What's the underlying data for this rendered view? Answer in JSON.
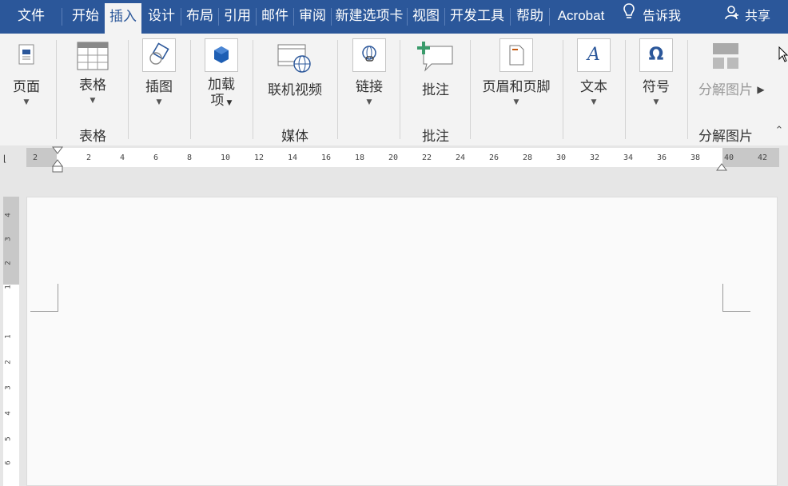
{
  "tabs": [
    {
      "label": "文件",
      "active": false
    },
    {
      "label": "开始",
      "active": false
    },
    {
      "label": "插入",
      "active": true
    },
    {
      "label": "设计",
      "active": false
    },
    {
      "label": "布局",
      "active": false
    },
    {
      "label": "引用",
      "active": false
    },
    {
      "label": "邮件",
      "active": false
    },
    {
      "label": "审阅",
      "active": false
    },
    {
      "label": "新建选项卡",
      "active": false
    },
    {
      "label": "视图",
      "active": false
    },
    {
      "label": "开发工具",
      "active": false
    },
    {
      "label": "帮助",
      "active": false
    },
    {
      "label": "Acrobat",
      "active": false
    }
  ],
  "tell_me": "告诉我",
  "share": "共享",
  "ribbon": {
    "page_label": "页面",
    "table_label": "表格",
    "illustration_label": "插图",
    "addins_label_1": "加载",
    "addins_label_2": "项",
    "online_video_label": "联机视频",
    "link_label": "链接",
    "comment_label": "批注",
    "header_footer_label": "页眉和页脚",
    "text_label": "文本",
    "symbol_label": "符号",
    "split_image_label": "分解图片",
    "groups": {
      "table": "表格",
      "media": "媒体",
      "comment": "批注",
      "split_image": "分解图片"
    }
  },
  "ruler": {
    "h_ticks": [
      "2",
      "2",
      "4",
      "6",
      "8",
      "10",
      "12",
      "14",
      "16",
      "18",
      "20",
      "22",
      "24",
      "26",
      "28",
      "30",
      "32",
      "34",
      "36",
      "38",
      "40",
      "42"
    ],
    "v_ticks": [
      "4",
      "3",
      "2",
      "1",
      "1",
      "2",
      "3",
      "4",
      "5",
      "6"
    ]
  },
  "colors": {
    "accent": "#2b579a",
    "ribbon_bg": "#f3f3f3"
  }
}
